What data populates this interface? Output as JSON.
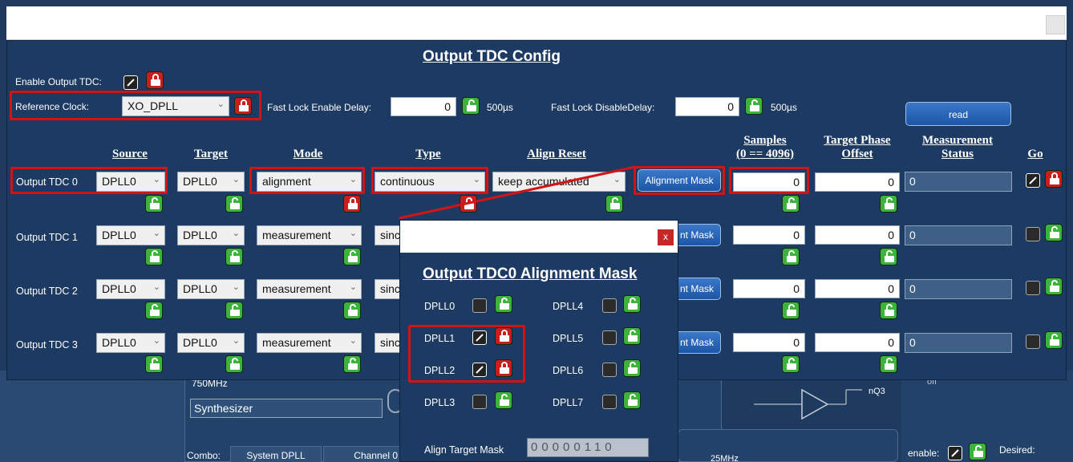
{
  "title": "Output TDC Config",
  "enable_label": "Enable Output TDC:",
  "refclk": {
    "label": "Reference Clock:",
    "value": "XO_DPLL"
  },
  "fast_lock_enable": {
    "label": "Fast Lock Enable Delay:",
    "value": "0",
    "unit": "500µs"
  },
  "fast_lock_disable": {
    "label": "Fast Lock DisableDelay:",
    "value": "0",
    "unit": "500µs"
  },
  "read_label": "read",
  "headers": {
    "source": "Source",
    "target": "Target",
    "mode": "Mode",
    "type": "Type",
    "align_reset": "Align Reset",
    "samples_1": "Samples",
    "samples_2": "(0 == 4096)",
    "target_phase_1": "Target Phase",
    "target_phase_2": "Offset",
    "meas_status_1": "Measurement",
    "meas_status_2": "Status",
    "go": "Go"
  },
  "rows": [
    {
      "label": "Output TDC 0",
      "source": "DPLL0",
      "target": "DPLL0",
      "mode": "alignment",
      "type": "continuous",
      "align_reset": "keep accumulated",
      "mask_btn": "Alignment Mask",
      "samples": "0",
      "phase": "0",
      "status": "0"
    },
    {
      "label": "Output TDC 1",
      "source": "DPLL0",
      "target": "DPLL0",
      "mode": "measurement",
      "type": "sinc",
      "mask_btn": "nt Mask",
      "samples": "0",
      "phase": "0",
      "status": "0"
    },
    {
      "label": "Output TDC 2",
      "source": "DPLL0",
      "target": "DPLL0",
      "mode": "measurement",
      "type": "sinc",
      "mask_btn": "nt Mask",
      "samples": "0",
      "phase": "0",
      "status": "0"
    },
    {
      "label": "Output TDC 3",
      "source": "DPLL0",
      "target": "DPLL0",
      "mode": "measurement",
      "type": "sinc",
      "mask_btn": "nt Mask",
      "samples": "0",
      "phase": "0",
      "status": "0"
    }
  ],
  "popup": {
    "title": "Output TDC0 Alignment Mask",
    "close": "x",
    "left_labels": [
      "DPLL0",
      "DPLL1",
      "DPLL2",
      "DPLL3"
    ],
    "right_labels": [
      "DPLL4",
      "DPLL5",
      "DPLL6",
      "DPLL7"
    ],
    "align_target_label": "Align Target Mask",
    "mask_value": "00000110"
  },
  "background": {
    "freq": "750MHz",
    "synth": "Synthesizer",
    "combo": "Combo:",
    "system_dpll": "System DPLL",
    "channel": "Channel 0",
    "nq3": "nQ3",
    "off": "off",
    "freq2": "25MHz",
    "enable": "enable:",
    "desired": "Desired:"
  },
  "colors": {
    "panel": "#1d3a63",
    "lock_unlocked": "#3cb43c",
    "lock_locked": "#c81e1e",
    "highlight": "#d41414",
    "button": "#2b66b8"
  }
}
